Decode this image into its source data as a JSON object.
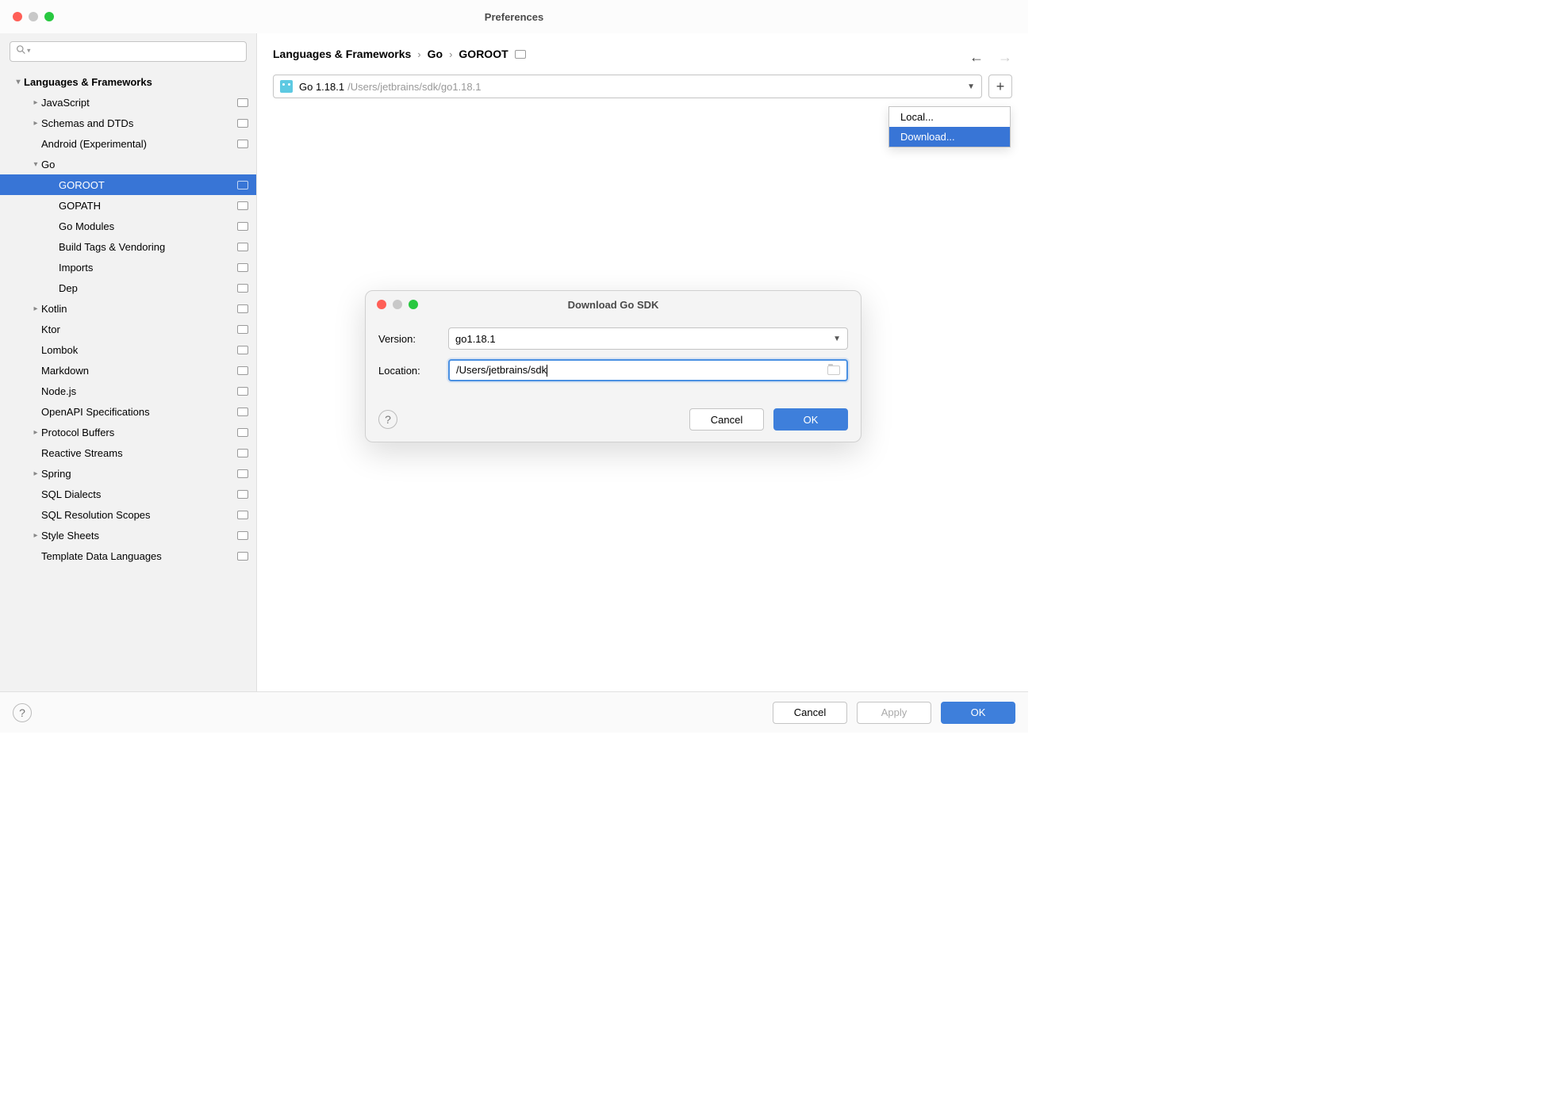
{
  "window": {
    "title": "Preferences"
  },
  "search": {
    "placeholder": ""
  },
  "sidebar": {
    "root": "Languages & Frameworks",
    "items": [
      {
        "label": "JavaScript",
        "level": 1,
        "chev": "right",
        "badge": true
      },
      {
        "label": "Schemas and DTDs",
        "level": 1,
        "chev": "right",
        "badge": true
      },
      {
        "label": "Android (Experimental)",
        "level": 1,
        "chev": "",
        "badge": true
      },
      {
        "label": "Go",
        "level": 1,
        "chev": "down",
        "badge": false
      },
      {
        "label": "GOROOT",
        "level": 2,
        "chev": "",
        "badge": true,
        "selected": true
      },
      {
        "label": "GOPATH",
        "level": 2,
        "chev": "",
        "badge": true
      },
      {
        "label": "Go Modules",
        "level": 2,
        "chev": "",
        "badge": true
      },
      {
        "label": "Build Tags & Vendoring",
        "level": 2,
        "chev": "",
        "badge": true
      },
      {
        "label": "Imports",
        "level": 2,
        "chev": "",
        "badge": true
      },
      {
        "label": "Dep",
        "level": 2,
        "chev": "",
        "badge": true
      },
      {
        "label": "Kotlin",
        "level": 1,
        "chev": "right",
        "badge": true
      },
      {
        "label": "Ktor",
        "level": 1,
        "chev": "",
        "badge": true
      },
      {
        "label": "Lombok",
        "level": 1,
        "chev": "",
        "badge": true
      },
      {
        "label": "Markdown",
        "level": 1,
        "chev": "",
        "badge": true
      },
      {
        "label": "Node.js",
        "level": 1,
        "chev": "",
        "badge": true
      },
      {
        "label": "OpenAPI Specifications",
        "level": 1,
        "chev": "",
        "badge": true
      },
      {
        "label": "Protocol Buffers",
        "level": 1,
        "chev": "right",
        "badge": true
      },
      {
        "label": "Reactive Streams",
        "level": 1,
        "chev": "",
        "badge": true
      },
      {
        "label": "Spring",
        "level": 1,
        "chev": "right",
        "badge": true
      },
      {
        "label": "SQL Dialects",
        "level": 1,
        "chev": "",
        "badge": true
      },
      {
        "label": "SQL Resolution Scopes",
        "level": 1,
        "chev": "",
        "badge": true
      },
      {
        "label": "Style Sheets",
        "level": 1,
        "chev": "right",
        "badge": true
      },
      {
        "label": "Template Data Languages",
        "level": 1,
        "chev": "",
        "badge": true
      }
    ]
  },
  "breadcrumb": {
    "c0": "Languages & Frameworks",
    "c1": "Go",
    "c2": "GOROOT"
  },
  "sdk": {
    "name": "Go 1.18.1",
    "path": "/Users/jetbrains/sdk/go1.18.1"
  },
  "popup": {
    "local": "Local...",
    "download": "Download..."
  },
  "dialog": {
    "title": "Download Go SDK",
    "version_label": "Version:",
    "version_value": "go1.18.1",
    "location_label": "Location:",
    "location_value": "/Users/jetbrains/sdk",
    "cancel": "Cancel",
    "ok": "OK"
  },
  "bottombar": {
    "cancel": "Cancel",
    "apply": "Apply",
    "ok": "OK"
  }
}
